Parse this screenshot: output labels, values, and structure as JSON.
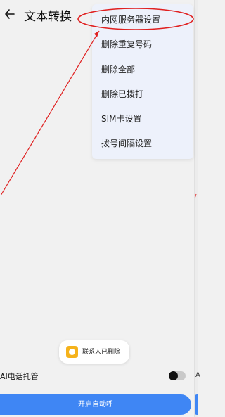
{
  "header": {
    "title": "文本转换"
  },
  "menu": {
    "items": [
      {
        "label": "内网服务器设置"
      },
      {
        "label": "删除重复号码"
      },
      {
        "label": "删除全部"
      },
      {
        "label": "删除已拨打"
      },
      {
        "label": "SIM卡设置"
      },
      {
        "label": "拨号间隔设置"
      }
    ]
  },
  "toast": {
    "text": "联系人已删除"
  },
  "settings": {
    "ai_label": "AI电话托管",
    "ai_toggle_on": false
  },
  "actions": {
    "start_label": "开启自动呼"
  },
  "colors": {
    "accent": "#3f86f4",
    "annotation": "#e02020",
    "menu_bg": "#edf1fb"
  },
  "icons": [
    "back-arrow-icon",
    "contacts-app-icon"
  ]
}
